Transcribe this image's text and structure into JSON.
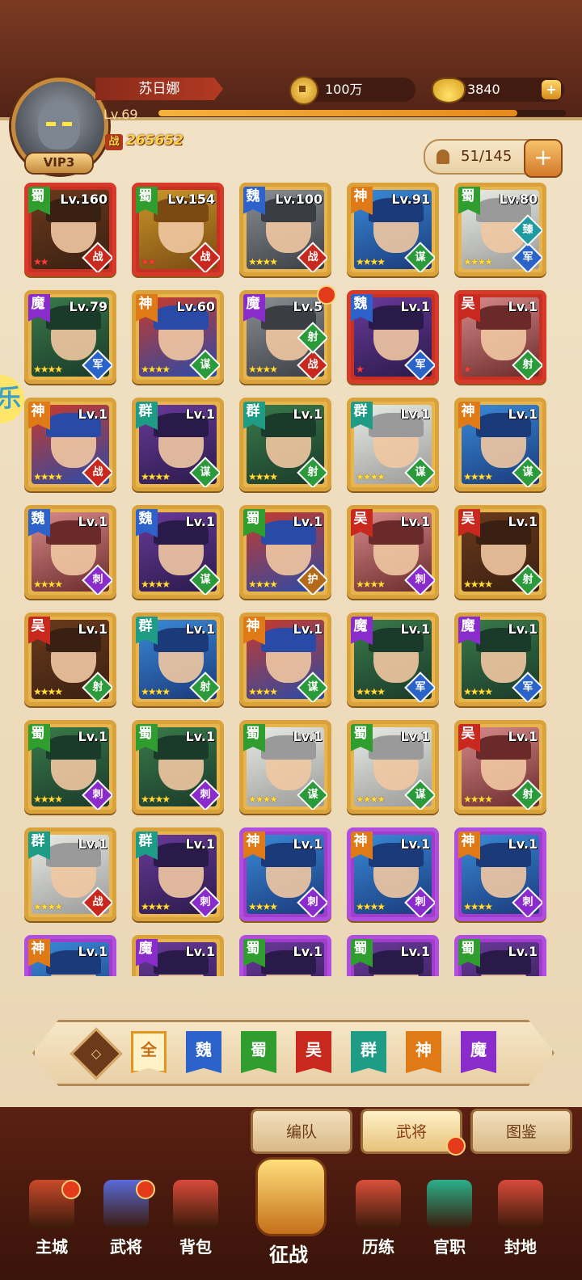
{
  "player": {
    "name": "苏日娜",
    "vip": "VIP3",
    "level": "Lv.69",
    "xp_fraction": 0.88,
    "power_icon": "战",
    "power": "265652"
  },
  "currency": {
    "copper": "100万",
    "gold": "3840",
    "plus": "+"
  },
  "roster": {
    "count": "51/145",
    "plus": "+"
  },
  "side_bubble": "乐",
  "heroes": [
    {
      "faction": "蜀",
      "level": "Lv.160",
      "stars": "★★",
      "star_color": "red",
      "role": "战",
      "frame": "red",
      "palette": "brown"
    },
    {
      "faction": "蜀",
      "level": "Lv.154",
      "stars": "★★",
      "star_color": "red",
      "role": "战",
      "frame": "red",
      "palette": "gold"
    },
    {
      "faction": "魏",
      "level": "Lv.100",
      "stars": "★★★★",
      "star_color": "gold",
      "role": "战",
      "frame": "gold",
      "palette": "grey"
    },
    {
      "faction": "神",
      "level": "Lv.91",
      "stars": "★★★★",
      "star_color": "gold",
      "role": "谋",
      "frame": "gold",
      "palette": "blue"
    },
    {
      "faction": "蜀",
      "level": "Lv.80",
      "stars": "★★★★",
      "star_color": "gold",
      "role": "军",
      "side": "臻",
      "frame": "gold",
      "palette": "white"
    },
    {
      "faction": "魔",
      "level": "Lv.79",
      "stars": "★★★★",
      "star_color": "gold",
      "role": "军",
      "frame": "gold",
      "palette": "green"
    },
    {
      "faction": "神",
      "level": "Lv.60",
      "stars": "★★★★",
      "star_color": "gold",
      "role": "谋",
      "frame": "gold",
      "palette": "redmask"
    },
    {
      "faction": "魔",
      "level": "Lv.5",
      "stars": "★★★★",
      "star_color": "gold",
      "role": "战",
      "side": "射",
      "frame": "gold",
      "palette": "grey",
      "notif": true
    },
    {
      "faction": "魏",
      "level": "Lv.1",
      "stars": "★",
      "star_color": "red",
      "role": "军",
      "frame": "red",
      "palette": "purple"
    },
    {
      "faction": "吴",
      "level": "Lv.1",
      "stars": "★",
      "star_color": "red",
      "role": "射",
      "frame": "red",
      "palette": "pink"
    },
    {
      "faction": "神",
      "level": "Lv.1",
      "stars": "★★★★",
      "star_color": "gold",
      "role": "战",
      "frame": "gold",
      "palette": "redmask"
    },
    {
      "faction": "群",
      "level": "Lv.1",
      "stars": "★★★★",
      "star_color": "gold",
      "role": "谋",
      "frame": "gold",
      "palette": "purple"
    },
    {
      "faction": "群",
      "level": "Lv.1",
      "stars": "★★★★",
      "star_color": "gold",
      "role": "射",
      "frame": "gold",
      "palette": "green"
    },
    {
      "faction": "群",
      "level": "Lv.1",
      "stars": "★★★★",
      "star_color": "gold",
      "role": "谋",
      "frame": "gold",
      "palette": "white"
    },
    {
      "faction": "神",
      "level": "Lv.1",
      "stars": "★★★★",
      "star_color": "gold",
      "role": "谋",
      "frame": "gold",
      "palette": "blue"
    },
    {
      "faction": "魏",
      "level": "Lv.1",
      "stars": "★★★★",
      "star_color": "gold",
      "role": "刺",
      "frame": "gold",
      "palette": "pink"
    },
    {
      "faction": "魏",
      "level": "Lv.1",
      "stars": "★★★★",
      "star_color": "gold",
      "role": "谋",
      "frame": "gold",
      "palette": "purple"
    },
    {
      "faction": "蜀",
      "level": "Lv.1",
      "stars": "★★★★",
      "star_color": "gold",
      "role": "护",
      "frame": "gold",
      "palette": "redmask"
    },
    {
      "faction": "吴",
      "level": "Lv.1",
      "stars": "★★★★",
      "star_color": "gold",
      "role": "刺",
      "frame": "gold",
      "palette": "pink"
    },
    {
      "faction": "吴",
      "level": "Lv.1",
      "stars": "★★★★",
      "star_color": "gold",
      "role": "射",
      "frame": "gold",
      "palette": "brown"
    },
    {
      "faction": "吴",
      "level": "Lv.1",
      "stars": "★★★★",
      "star_color": "gold",
      "role": "射",
      "frame": "gold",
      "palette": "brown"
    },
    {
      "faction": "群",
      "level": "Lv.1",
      "stars": "★★★★",
      "star_color": "gold",
      "role": "射",
      "frame": "gold",
      "palette": "blue"
    },
    {
      "faction": "神",
      "level": "Lv.1",
      "stars": "★★★★",
      "star_color": "gold",
      "role": "谋",
      "frame": "gold",
      "palette": "redmask"
    },
    {
      "faction": "魔",
      "level": "Lv.1",
      "stars": "★★★★",
      "star_color": "gold",
      "role": "军",
      "frame": "gold",
      "palette": "green"
    },
    {
      "faction": "魔",
      "level": "Lv.1",
      "stars": "★★★★",
      "star_color": "gold",
      "role": "军",
      "frame": "gold",
      "palette": "green"
    },
    {
      "faction": "蜀",
      "level": "Lv.1",
      "stars": "★★★★",
      "star_color": "gold",
      "role": "刺",
      "frame": "gold",
      "palette": "green"
    },
    {
      "faction": "蜀",
      "level": "Lv.1",
      "stars": "★★★★",
      "star_color": "gold",
      "role": "刺",
      "frame": "gold",
      "palette": "green"
    },
    {
      "faction": "蜀",
      "level": "Lv.1",
      "stars": "★★★★",
      "star_color": "gold",
      "role": "谋",
      "frame": "gold",
      "palette": "white"
    },
    {
      "faction": "蜀",
      "level": "Lv.1",
      "stars": "★★★★",
      "star_color": "gold",
      "role": "谋",
      "frame": "gold",
      "palette": "white"
    },
    {
      "faction": "吴",
      "level": "Lv.1",
      "stars": "★★★★",
      "star_color": "gold",
      "role": "射",
      "frame": "gold",
      "palette": "pink"
    },
    {
      "faction": "群",
      "level": "Lv.1",
      "stars": "★★★★",
      "star_color": "gold",
      "role": "战",
      "frame": "gold",
      "palette": "white"
    },
    {
      "faction": "群",
      "level": "Lv.1",
      "stars": "★★★★",
      "star_color": "gold",
      "role": "刺",
      "frame": "gold",
      "palette": "purple"
    },
    {
      "faction": "神",
      "level": "Lv.1",
      "stars": "★★★★",
      "star_color": "gold",
      "role": "刺",
      "frame": "purple",
      "palette": "blue"
    },
    {
      "faction": "神",
      "level": "Lv.1",
      "stars": "★★★★",
      "star_color": "gold",
      "role": "刺",
      "frame": "purple",
      "palette": "blue"
    },
    {
      "faction": "神",
      "level": "Lv.1",
      "stars": "★★★★",
      "star_color": "gold",
      "role": "刺",
      "frame": "purple",
      "palette": "blue"
    },
    {
      "faction": "神",
      "level": "Lv.1",
      "stars": "",
      "star_color": "gold",
      "role": "",
      "frame": "purple",
      "palette": "blue"
    },
    {
      "faction": "魔",
      "level": "Lv.1",
      "stars": "",
      "star_color": "gold",
      "role": "",
      "frame": "gold",
      "palette": "purple"
    },
    {
      "faction": "蜀",
      "level": "Lv.1",
      "stars": "",
      "star_color": "gold",
      "role": "",
      "frame": "purple",
      "palette": "purple"
    },
    {
      "faction": "蜀",
      "level": "Lv.1",
      "stars": "",
      "star_color": "gold",
      "role": "",
      "frame": "purple",
      "palette": "purple"
    },
    {
      "faction": "蜀",
      "level": "Lv.1",
      "stars": "",
      "star_color": "gold",
      "role": "",
      "frame": "purple",
      "palette": "purple"
    }
  ],
  "faction_colors": {
    "蜀": "#2f9e2f",
    "魏": "#2c62c9",
    "吴": "#c8281e",
    "群": "#1e9c86",
    "神": "#e07a16",
    "魔": "#8a2ccb"
  },
  "role_colors": {
    "战": "#c8281e",
    "谋": "#2a9a3a",
    "军": "#2a64c8",
    "射": "#2a9a3a",
    "刺": "#8a2ccb",
    "护": "#b36a1a",
    "臻": "#1f9aa0"
  },
  "filter": {
    "icon": "◇",
    "buttons": [
      {
        "label": "全",
        "color": "#fff2c8",
        "active": true
      },
      {
        "label": "魏",
        "color": "#2c62c9"
      },
      {
        "label": "蜀",
        "color": "#2f9e2f"
      },
      {
        "label": "吴",
        "color": "#c8281e"
      },
      {
        "label": "群",
        "color": "#1e9c86"
      },
      {
        "label": "神",
        "color": "#e07a16"
      },
      {
        "label": "魔",
        "color": "#8a2ccb"
      }
    ]
  },
  "tabs": [
    {
      "label": "编队"
    },
    {
      "label": "武将",
      "active": true,
      "notif": true
    },
    {
      "label": "图鉴"
    }
  ],
  "nav": [
    {
      "label": "主城",
      "icon": "city-icon",
      "color": "#c94a2a",
      "notif": true
    },
    {
      "label": "武将",
      "icon": "general-icon",
      "color": "#5a6ad8",
      "notif": true
    },
    {
      "label": "背包",
      "icon": "bag-icon",
      "color": "#d84a3a"
    },
    {
      "label": "征战",
      "icon": "battle-icon",
      "color": "#e09a2a",
      "center": true
    },
    {
      "label": "历练",
      "icon": "training-icon",
      "color": "#d8503a"
    },
    {
      "label": "官职",
      "icon": "office-icon",
      "color": "#2ab08a"
    },
    {
      "label": "封地",
      "icon": "fief-icon",
      "color": "#d84a3a"
    }
  ]
}
